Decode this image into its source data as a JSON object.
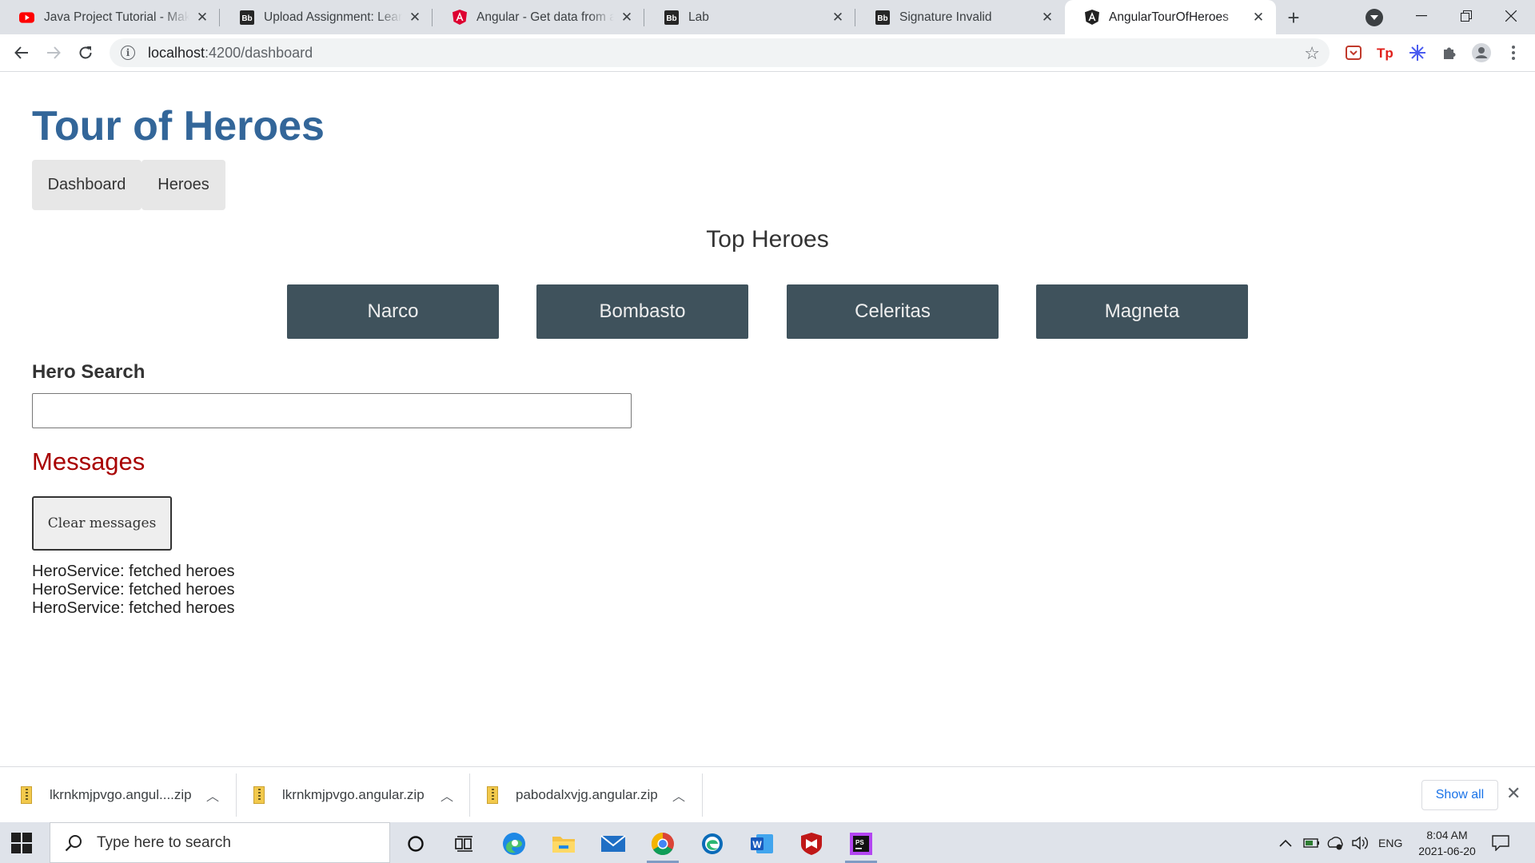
{
  "browser": {
    "tabs": [
      {
        "title": "Java Project Tutorial - Make",
        "icon": "youtube-icon"
      },
      {
        "title": "Upload Assignment: Learnin",
        "icon": "blackboard-icon"
      },
      {
        "title": "Angular - Get data from a se",
        "icon": "angular-icon"
      },
      {
        "title": "Lab",
        "icon": "blackboard-icon"
      },
      {
        "title": "Signature Invalid",
        "icon": "blackboard-icon"
      },
      {
        "title": "AngularTourOfHeroes",
        "icon": "angular-icon"
      }
    ],
    "active_tab": 5,
    "url": "localhost:4200/dashboard",
    "url_host": "localhost",
    "url_rest": ":4200/dashboard"
  },
  "app": {
    "title": "Tour of Heroes",
    "nav": [
      "Dashboard",
      "Heroes"
    ],
    "top_heroes_title": "Top Heroes",
    "top_heroes": [
      "Narco",
      "Bombasto",
      "Celeritas",
      "Magneta"
    ],
    "search_label": "Hero Search",
    "search_value": "",
    "messages_title": "Messages",
    "clear_label": "Clear messages",
    "messages": [
      "HeroService: fetched heroes",
      "HeroService: fetched heroes",
      "HeroService: fetched heroes"
    ]
  },
  "downloads": {
    "items": [
      "lkrnkmjpvgo.angul....zip",
      "lkrnkmjpvgo.angular.zip",
      "pabodalxvjg.angular.zip"
    ],
    "show_all": "Show all"
  },
  "taskbar": {
    "search_placeholder": "Type here to search",
    "lang": "ENG",
    "time": "8:04 AM",
    "date": "2021-06-20"
  },
  "colors": {
    "title_blue": "#336699",
    "hero_card": "#3f525c",
    "messages_red": "#a80000",
    "nav_bg": "#e7e7e7"
  }
}
